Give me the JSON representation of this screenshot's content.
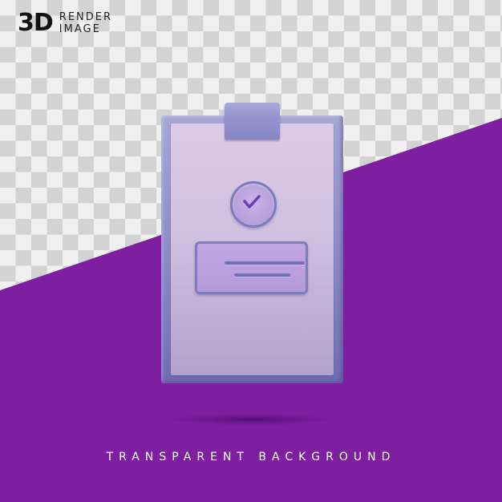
{
  "brand": {
    "mark": "3D",
    "line1": "RENDER",
    "line2": "IMAGE"
  },
  "footer": {
    "caption": "TRANSPARENT BACKGROUND"
  },
  "colors": {
    "purple_background": "#7e1fa0",
    "checker_light": "#f0f0f0",
    "checker_dark": "#d3d3d3",
    "board": "#8e8cc8",
    "paper": "#d2c4e2",
    "accent_stroke": "#7371b4",
    "check_mark": "#6a3cb5"
  },
  "icon": {
    "subject": "clipboard-with-checkmark",
    "elements": [
      "clipboard-clip",
      "check-circle",
      "text-box"
    ]
  }
}
